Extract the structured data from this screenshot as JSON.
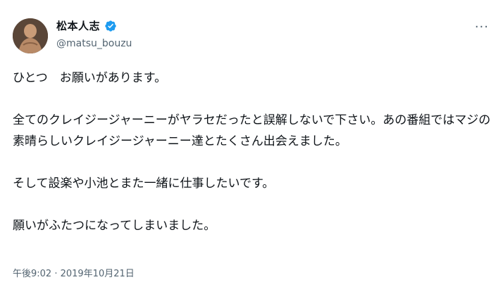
{
  "author": {
    "display_name": "松本人志",
    "handle": "@matsu_bouzu",
    "avatar_icon": "avatar-photo",
    "verified_icon": "verified-badge-icon",
    "verified_color": "#1d9bf0"
  },
  "more_icon": "more-options-icon",
  "paragraphs": [
    "ひとつ　お願いがあります。",
    "全てのクレイジージャーニーがヤラセだったと誤解しないで下さい。あの番組ではマジの素晴らしいクレイジージャーニー達とたくさん出会えました。",
    "そして設楽や小池とまた一緒に仕事したいです。",
    "願いがふたつになってしまいました。"
  ],
  "timestamp": "午後9:02 · 2019年10月21日"
}
